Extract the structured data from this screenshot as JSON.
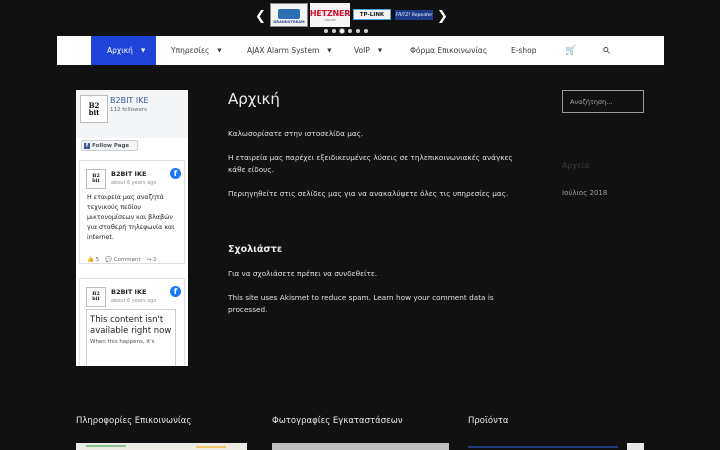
{
  "carousel": {
    "prev_icon": "chevron-left-icon",
    "next_icon": "chevron-right-icon",
    "logos": [
      {
        "name": "Grandstream",
        "text": "GRANDSTREAM"
      },
      {
        "name": "Hetzner",
        "text": "HETZNER",
        "sub": "ONLINE"
      },
      {
        "name": "TP-Link",
        "text": "TP-LINK"
      },
      {
        "name": "Fritz",
        "text": "FRITZ! Repeater"
      }
    ],
    "dot_count": 6,
    "active_dot": 2
  },
  "nav": {
    "items": [
      {
        "label": "Αρχική",
        "dropdown": true,
        "active": true
      },
      {
        "label": "Υπηρεσίες",
        "dropdown": true
      },
      {
        "label": "AJAX Alarm System",
        "dropdown": true
      },
      {
        "label": "VoIP",
        "dropdown": true
      },
      {
        "label": "Φόρμα Επικοινωνίας",
        "dropdown": false
      },
      {
        "label": "E-shop",
        "dropdown": false
      }
    ],
    "caret_glyph": "▼",
    "cart_icon": "cart-icon",
    "cart_glyph": "🛒",
    "search_icon": "search-icon",
    "search_glyph": "⚲"
  },
  "facebook": {
    "page_name": "B2BIT IKE",
    "followers": "112 followers",
    "avatar_text": "B2\nbit",
    "follow_button": "Follow Page",
    "follow_icon_glyph": "f",
    "logo_glyph": "f",
    "posts": [
      {
        "author": "B2BIT IKE",
        "time": "about 6 years ago",
        "text": "Η εταιρεία μας αναζητά τεχνικούς πεδίου μικτονομίσεων και βλαβών για σταθερή τηλεφωνία και internet.",
        "likes": "5",
        "comment_label": "Comment",
        "shares": "2"
      },
      {
        "author": "B2BIT IKE",
        "time": "about 6 years ago",
        "notice_title": "This content isn't available right now",
        "notice_sub": "When this happens, it's"
      }
    ]
  },
  "main": {
    "title": "Αρχική",
    "paragraphs": [
      "Καλωσορίσατε στην ιστοσελίδα μας.",
      "Η εταιρεία μας παρέχει εξειδικευμένες λύσεις σε τηλεπικοινωνιακές ανάγκες κάθε είδους.",
      "Περιηγηθείτε στις σελίδες μας για να ανακαλύψετε όλες τις υπηρεσίες μας."
    ],
    "comments_heading": "Σχολιάστε",
    "comment_notice": "Για να σχολιάσετε πρέπει να συνδεθείτε.",
    "akismet_notice": "This site uses Akismet to reduce spam. Learn how your comment data is processed."
  },
  "sidebar": {
    "search_placeholder": "Αναζήτηση...",
    "archive_heading": "Αρχεία",
    "archive_items": [
      "Ιούλιος 2018"
    ]
  },
  "footer": {
    "col1_title": "Πληροφορίες Επικοινωνίας",
    "col2_title": "Φωτογραφίες Εγκαταστάσεων",
    "col3_title": "Προϊόντα"
  },
  "colors": {
    "background": "#111111",
    "nav_active": "#1e43d6",
    "nav_bg": "#ffffff",
    "facebook_blue": "#1877f2"
  }
}
